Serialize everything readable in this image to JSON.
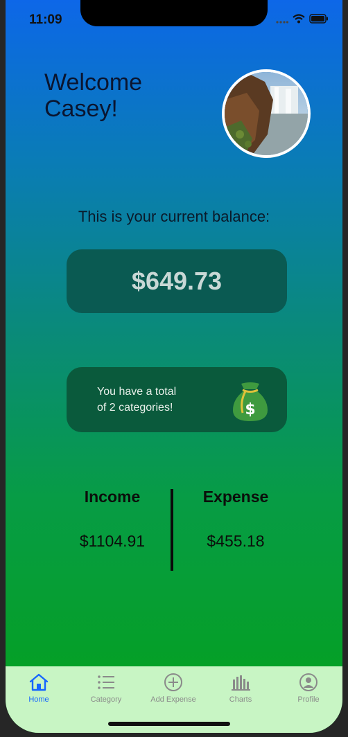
{
  "status_bar": {
    "time": "11:09",
    "icons": [
      "signal-icon",
      "wifi-icon",
      "battery-icon"
    ]
  },
  "header": {
    "welcome_line1": "Welcome",
    "welcome_line2": "Casey!",
    "avatar_icon": "landscape-photo-avatar"
  },
  "balance": {
    "label": "This is your current balance:",
    "value": "$649.73"
  },
  "categories_card": {
    "text_line1": "You have a total",
    "text_line2": "of 2 categories!",
    "icon": "money-bag-icon"
  },
  "summary": {
    "income_label": "Income",
    "income_value": "$1104.91",
    "expense_label": "Expense",
    "expense_value": "$455.18"
  },
  "tab_bar": {
    "tabs": [
      {
        "label": "Home",
        "icon": "home-icon",
        "active": true
      },
      {
        "label": "Category",
        "icon": "list-icon",
        "active": false
      },
      {
        "label": "Add Expense",
        "icon": "plus-circle-icon",
        "active": false
      },
      {
        "label": "Charts",
        "icon": "bar-chart-icon",
        "active": false
      },
      {
        "label": "Profile",
        "icon": "person-circle-icon",
        "active": false
      }
    ]
  },
  "colors": {
    "gradient_top": "#0d67e8",
    "gradient_bottom": "#04a11b",
    "balance_card": "#0a5a52",
    "category_card": "#0a5a3c",
    "tab_bar": "#c8f5c4",
    "active_tab": "#1565ff",
    "inactive_tab": "#8a8a8a"
  }
}
